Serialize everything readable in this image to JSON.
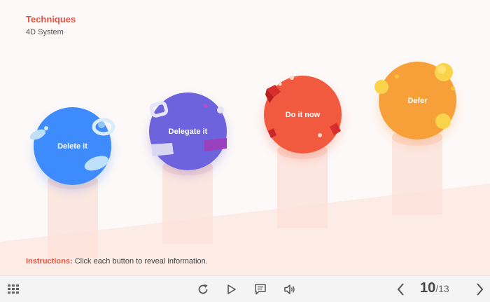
{
  "header": {
    "title": "Techniques",
    "subtitle": "4D System"
  },
  "buttons": [
    {
      "label": "Delete it",
      "color": "#3d8bfd"
    },
    {
      "label": "Delegate it",
      "color": "#6d63dc"
    },
    {
      "label": "Do it now",
      "color": "#f25a3f"
    },
    {
      "label": "Defer",
      "color": "#f7a03a"
    }
  ],
  "instructions": {
    "label": "Instructions:",
    "text": "Click each button to reveal information."
  },
  "toolbar": {
    "menu_icon": "grid-icon",
    "replay_icon": "replay-icon",
    "play_icon": "play-icon",
    "notes_icon": "notes-icon",
    "audio_icon": "audio-icon",
    "prev_icon": "chevron-left-icon",
    "next_icon": "chevron-right-icon",
    "current_page": "10",
    "total_pages": "/13"
  },
  "colors": {
    "accent": "#e8533f",
    "stair": "#fde9e4"
  }
}
